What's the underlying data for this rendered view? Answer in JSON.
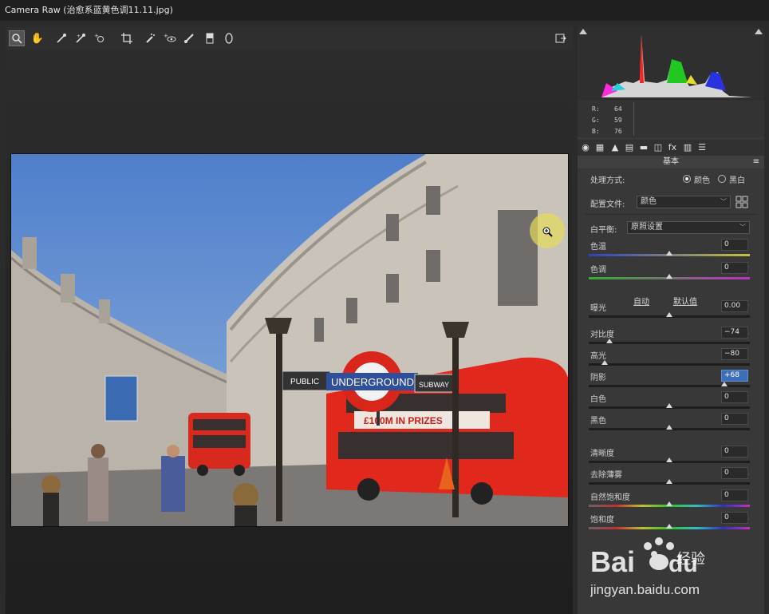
{
  "window": {
    "title": "Camera Raw (治愈系蓝黄色调11.11.jpg)"
  },
  "toolbar": {
    "tools": [
      "zoom-icon",
      "hand-icon",
      "white-balance-icon",
      "color-sampler-icon",
      "targeted-adjustment-icon",
      "crop-icon",
      "spot-removal-icon",
      "red-eye-icon",
      "adjustment-brush-icon",
      "graduated-filter-icon",
      "radial-filter-icon"
    ]
  },
  "info": {
    "r_label": "R:",
    "r_value": "64",
    "g_label": "G:",
    "g_value": "59",
    "b_label": "B:",
    "b_value": "76"
  },
  "photo": {
    "sign_left": "PUBLIC",
    "sign_center": "UNDERGROUND",
    "sign_right": "SUBWAY",
    "bus_ad": "£100M IN PRIZES"
  },
  "panel": {
    "title": "基本",
    "treatment_label": "处理方式:",
    "treatment_color": "颜色",
    "treatment_bw": "黑白",
    "profile_label": "配置文件:",
    "profile_value": "颜色",
    "wb_label": "白平衡:",
    "wb_value": "原照设置",
    "auto_link": "自动",
    "default_link": "默认值"
  },
  "sliders": [
    {
      "label": "色温",
      "value": "0",
      "pos": 0.5,
      "track": "temp"
    },
    {
      "label": "色调",
      "value": "0",
      "pos": 0.5,
      "track": "tint"
    },
    {
      "label": "曝光",
      "value": "0.00",
      "pos": 0.5,
      "track": "dark"
    },
    {
      "label": "对比度",
      "value": "−74",
      "pos": 0.13,
      "track": "dark"
    },
    {
      "label": "高光",
      "value": "−80",
      "pos": 0.1,
      "track": "dark"
    },
    {
      "label": "阴影",
      "value": "+68",
      "pos": 0.84,
      "track": "dark",
      "selected": true
    },
    {
      "label": "白色",
      "value": "0",
      "pos": 0.5,
      "track": "dark"
    },
    {
      "label": "黑色",
      "value": "0",
      "pos": 0.5,
      "track": "dark"
    },
    {
      "label": "清晰度",
      "value": "0",
      "pos": 0.5,
      "track": "dark"
    },
    {
      "label": "去除薄雾",
      "value": "0",
      "pos": 0.5,
      "track": "dark"
    },
    {
      "label": "自然饱和度",
      "value": "0",
      "pos": 0.5,
      "track": "rainbow"
    },
    {
      "label": "饱和度",
      "value": "0",
      "pos": 0.5,
      "track": "rainbow"
    }
  ],
  "watermark": {
    "brand": "Baidu经验",
    "url": "jingyan.baidu.com"
  }
}
